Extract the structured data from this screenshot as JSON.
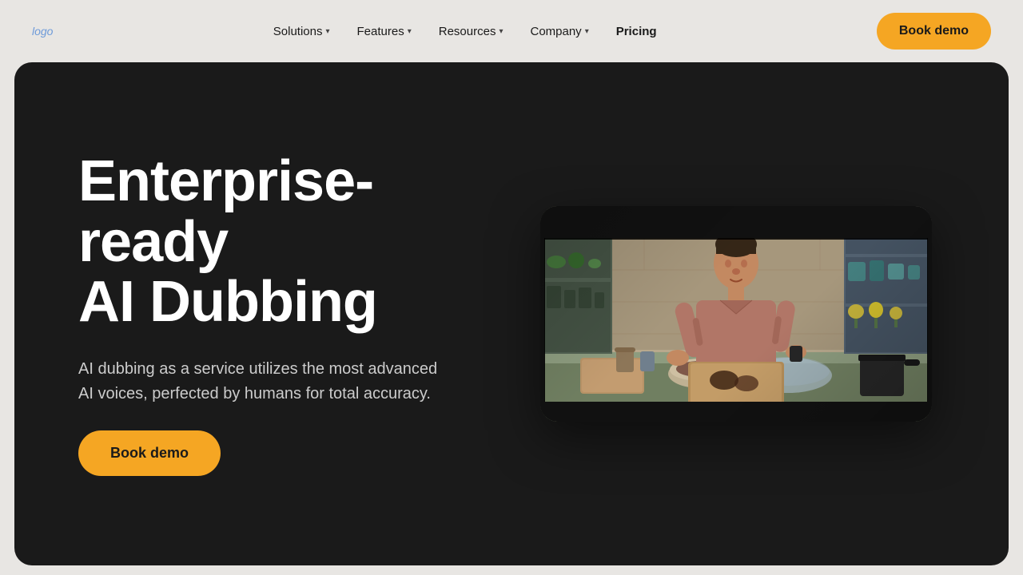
{
  "navbar": {
    "logo_alt": "logo",
    "nav_items": [
      {
        "label": "Solutions",
        "has_dropdown": true
      },
      {
        "label": "Features",
        "has_dropdown": true
      },
      {
        "label": "Resources",
        "has_dropdown": true
      },
      {
        "label": "Company",
        "has_dropdown": true
      },
      {
        "label": "Pricing",
        "has_dropdown": false
      }
    ],
    "cta_label": "Book demo"
  },
  "hero": {
    "title_line1": "Enterprise-ready",
    "title_line2": "AI Dubbing",
    "subtitle": "AI dubbing as a service utilizes the most advanced AI voices, perfected by humans for total accuracy.",
    "cta_label": "Book demo",
    "video_alt": "Person cooking in kitchen demonstrating AI dubbing"
  },
  "colors": {
    "accent": "#f5a623",
    "hero_bg": "#1a1a1a",
    "navbar_bg": "#e8e6e3",
    "text_dark": "#1a1a1a",
    "text_light": "#ffffff",
    "text_muted": "#cccccc"
  }
}
